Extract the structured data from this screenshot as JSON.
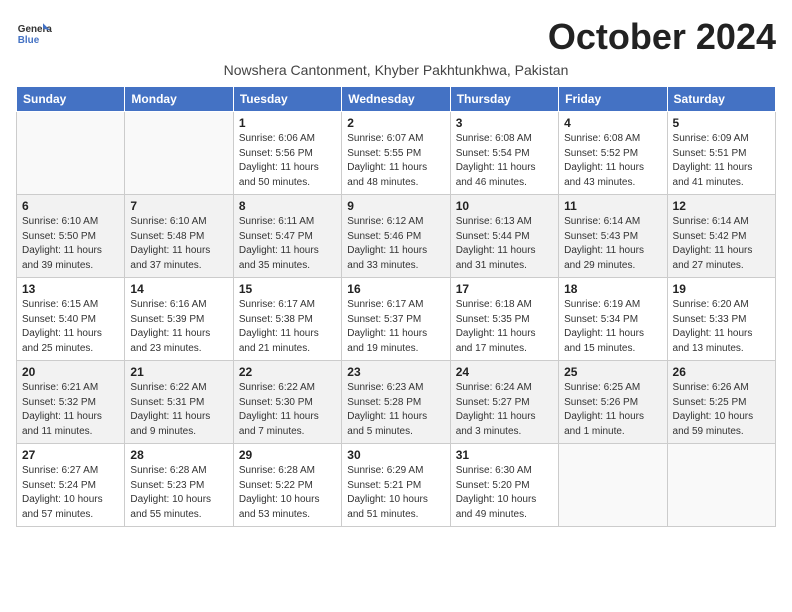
{
  "header": {
    "logo_line1": "General",
    "logo_line2": "Blue",
    "month_title": "October 2024",
    "subtitle": "Nowshera Cantonment, Khyber Pakhtunkhwa, Pakistan"
  },
  "days_of_week": [
    "Sunday",
    "Monday",
    "Tuesday",
    "Wednesday",
    "Thursday",
    "Friday",
    "Saturday"
  ],
  "weeks": [
    [
      {
        "day": "",
        "info": ""
      },
      {
        "day": "",
        "info": ""
      },
      {
        "day": "1",
        "info": "Sunrise: 6:06 AM\nSunset: 5:56 PM\nDaylight: 11 hours and 50 minutes."
      },
      {
        "day": "2",
        "info": "Sunrise: 6:07 AM\nSunset: 5:55 PM\nDaylight: 11 hours and 48 minutes."
      },
      {
        "day": "3",
        "info": "Sunrise: 6:08 AM\nSunset: 5:54 PM\nDaylight: 11 hours and 46 minutes."
      },
      {
        "day": "4",
        "info": "Sunrise: 6:08 AM\nSunset: 5:52 PM\nDaylight: 11 hours and 43 minutes."
      },
      {
        "day": "5",
        "info": "Sunrise: 6:09 AM\nSunset: 5:51 PM\nDaylight: 11 hours and 41 minutes."
      }
    ],
    [
      {
        "day": "6",
        "info": "Sunrise: 6:10 AM\nSunset: 5:50 PM\nDaylight: 11 hours and 39 minutes."
      },
      {
        "day": "7",
        "info": "Sunrise: 6:10 AM\nSunset: 5:48 PM\nDaylight: 11 hours and 37 minutes."
      },
      {
        "day": "8",
        "info": "Sunrise: 6:11 AM\nSunset: 5:47 PM\nDaylight: 11 hours and 35 minutes."
      },
      {
        "day": "9",
        "info": "Sunrise: 6:12 AM\nSunset: 5:46 PM\nDaylight: 11 hours and 33 minutes."
      },
      {
        "day": "10",
        "info": "Sunrise: 6:13 AM\nSunset: 5:44 PM\nDaylight: 11 hours and 31 minutes."
      },
      {
        "day": "11",
        "info": "Sunrise: 6:14 AM\nSunset: 5:43 PM\nDaylight: 11 hours and 29 minutes."
      },
      {
        "day": "12",
        "info": "Sunrise: 6:14 AM\nSunset: 5:42 PM\nDaylight: 11 hours and 27 minutes."
      }
    ],
    [
      {
        "day": "13",
        "info": "Sunrise: 6:15 AM\nSunset: 5:40 PM\nDaylight: 11 hours and 25 minutes."
      },
      {
        "day": "14",
        "info": "Sunrise: 6:16 AM\nSunset: 5:39 PM\nDaylight: 11 hours and 23 minutes."
      },
      {
        "day": "15",
        "info": "Sunrise: 6:17 AM\nSunset: 5:38 PM\nDaylight: 11 hours and 21 minutes."
      },
      {
        "day": "16",
        "info": "Sunrise: 6:17 AM\nSunset: 5:37 PM\nDaylight: 11 hours and 19 minutes."
      },
      {
        "day": "17",
        "info": "Sunrise: 6:18 AM\nSunset: 5:35 PM\nDaylight: 11 hours and 17 minutes."
      },
      {
        "day": "18",
        "info": "Sunrise: 6:19 AM\nSunset: 5:34 PM\nDaylight: 11 hours and 15 minutes."
      },
      {
        "day": "19",
        "info": "Sunrise: 6:20 AM\nSunset: 5:33 PM\nDaylight: 11 hours and 13 minutes."
      }
    ],
    [
      {
        "day": "20",
        "info": "Sunrise: 6:21 AM\nSunset: 5:32 PM\nDaylight: 11 hours and 11 minutes."
      },
      {
        "day": "21",
        "info": "Sunrise: 6:22 AM\nSunset: 5:31 PM\nDaylight: 11 hours and 9 minutes."
      },
      {
        "day": "22",
        "info": "Sunrise: 6:22 AM\nSunset: 5:30 PM\nDaylight: 11 hours and 7 minutes."
      },
      {
        "day": "23",
        "info": "Sunrise: 6:23 AM\nSunset: 5:28 PM\nDaylight: 11 hours and 5 minutes."
      },
      {
        "day": "24",
        "info": "Sunrise: 6:24 AM\nSunset: 5:27 PM\nDaylight: 11 hours and 3 minutes."
      },
      {
        "day": "25",
        "info": "Sunrise: 6:25 AM\nSunset: 5:26 PM\nDaylight: 11 hours and 1 minute."
      },
      {
        "day": "26",
        "info": "Sunrise: 6:26 AM\nSunset: 5:25 PM\nDaylight: 10 hours and 59 minutes."
      }
    ],
    [
      {
        "day": "27",
        "info": "Sunrise: 6:27 AM\nSunset: 5:24 PM\nDaylight: 10 hours and 57 minutes."
      },
      {
        "day": "28",
        "info": "Sunrise: 6:28 AM\nSunset: 5:23 PM\nDaylight: 10 hours and 55 minutes."
      },
      {
        "day": "29",
        "info": "Sunrise: 6:28 AM\nSunset: 5:22 PM\nDaylight: 10 hours and 53 minutes."
      },
      {
        "day": "30",
        "info": "Sunrise: 6:29 AM\nSunset: 5:21 PM\nDaylight: 10 hours and 51 minutes."
      },
      {
        "day": "31",
        "info": "Sunrise: 6:30 AM\nSunset: 5:20 PM\nDaylight: 10 hours and 49 minutes."
      },
      {
        "day": "",
        "info": ""
      },
      {
        "day": "",
        "info": ""
      }
    ]
  ]
}
